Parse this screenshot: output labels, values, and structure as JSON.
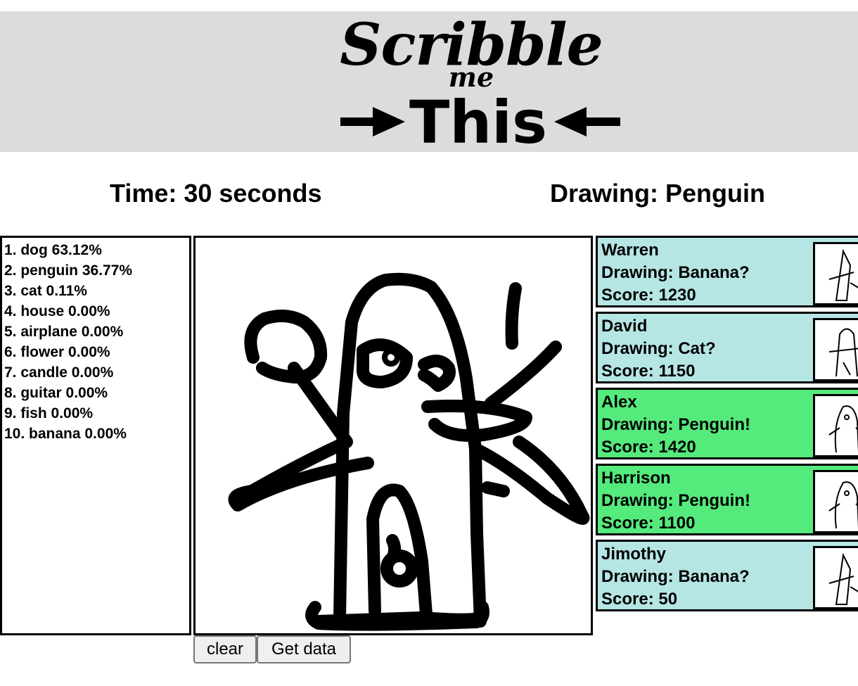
{
  "logo": {
    "line1": "Scribble",
    "line2": "me",
    "line3": "This"
  },
  "status": {
    "time": "Time: 30 seconds",
    "drawing": "Drawing: Penguin"
  },
  "predictions": [
    "1. dog 63.12%",
    "2. penguin 36.77%",
    "3. cat 0.11%",
    "4. house 0.00%",
    "5. airplane 0.00%",
    "6. flower 0.00%",
    "7. candle 0.00%",
    "8. guitar 0.00%",
    "9. fish 0.00%",
    "10. banana 0.00%"
  ],
  "buttons": {
    "clear": "clear",
    "get_data": "Get data"
  },
  "players": [
    {
      "name": "Warren",
      "drawing": "Drawing: Banana?",
      "score": "Score: 1230",
      "color": "#b5e6e4"
    },
    {
      "name": "David",
      "drawing": "Drawing: Cat?",
      "score": "Score: 1150",
      "color": "#b5e6e4"
    },
    {
      "name": "Alex",
      "drawing": "Drawing: Penguin!",
      "score": "Score: 1420",
      "color": "#55ea7c"
    },
    {
      "name": "Harrison",
      "drawing": "Drawing: Penguin!",
      "score": "Score: 1100",
      "color": "#55ea7c"
    },
    {
      "name": "Jimothy",
      "drawing": "Drawing: Banana?",
      "score": "Score: 50",
      "color": "#b5e6e4"
    }
  ]
}
